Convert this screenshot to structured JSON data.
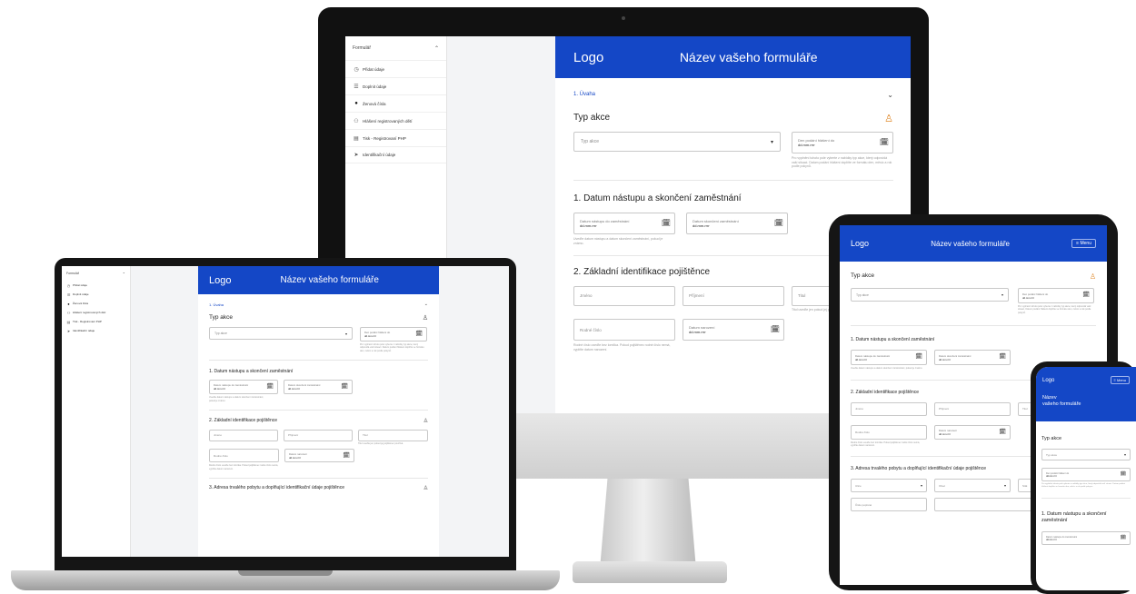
{
  "sidebar": {
    "title": "Formulář",
    "items": [
      {
        "icon": "clock-icon",
        "glyph": "◷",
        "label": "Přidat údaje"
      },
      {
        "icon": "list-icon",
        "glyph": "☰",
        "label": "Doplnit údaje"
      },
      {
        "icon": "dot-icon",
        "glyph": "●",
        "label": "Ženová čísla"
      },
      {
        "icon": "user-icon",
        "glyph": "⚇",
        "label": "Hlášení registrovaných dětí"
      },
      {
        "icon": "document-icon",
        "glyph": "▤",
        "label": "Tisk - Registrovaní PHP"
      },
      {
        "icon": "arrow-icon",
        "glyph": "➤",
        "label": "Identifikační údaje"
      }
    ]
  },
  "form": {
    "logo": "Logo",
    "title": "Název vašeho formuláře",
    "title_line1": "Název",
    "title_line2": "vašeho formuláře",
    "step": "1. Úvaha",
    "action_heading": "Typ akce",
    "action_placeholder": "Typ akce",
    "date_label": "Den podání hlášení do",
    "date_value": "dd.mm.rrrr",
    "action_help": "Pro vyplnění tohoto pole vyberte z nabídky typ akce, který odpovídá vaší situaci. Datum podání hlášení doplňte ve formátu den, měsíc a rok podle pokynů.",
    "section1": "1. Datum nástupu a skončení zaměstnání",
    "start_label": "Datum nástupu do zaměstnání",
    "end_label": "Datum skončení zaměstnání",
    "section1_help": "Uveďte datum nástupu a datum skončení zaměstnání, pokud je známo.",
    "section2": "2. Základní identifikace pojištěnce",
    "surname_placeholder": "Jméno",
    "firstname_placeholder": "Příjmení",
    "title_placeholder": "Titul",
    "title_help": "Titul uveďte jen pokud jej pojištěnec používá.",
    "birth_number_placeholder": "Rodné číslo",
    "birth_date_label": "Datum narození",
    "birth_help": "Rodné číslo uveďte bez lomítka. Pokud pojištěnec rodné číslo nemá, vyplňte datum narození.",
    "section3": "3. Adresa trvalého pobytu a doplňující identifikační údaje pojištěnce",
    "street_placeholder": "Ulice",
    "city_placeholder": "Obec",
    "zip_placeholder": "Číslo popisné",
    "country_placeholder": "Stát"
  },
  "menu_label": "≡",
  "menu_text": "Menu"
}
